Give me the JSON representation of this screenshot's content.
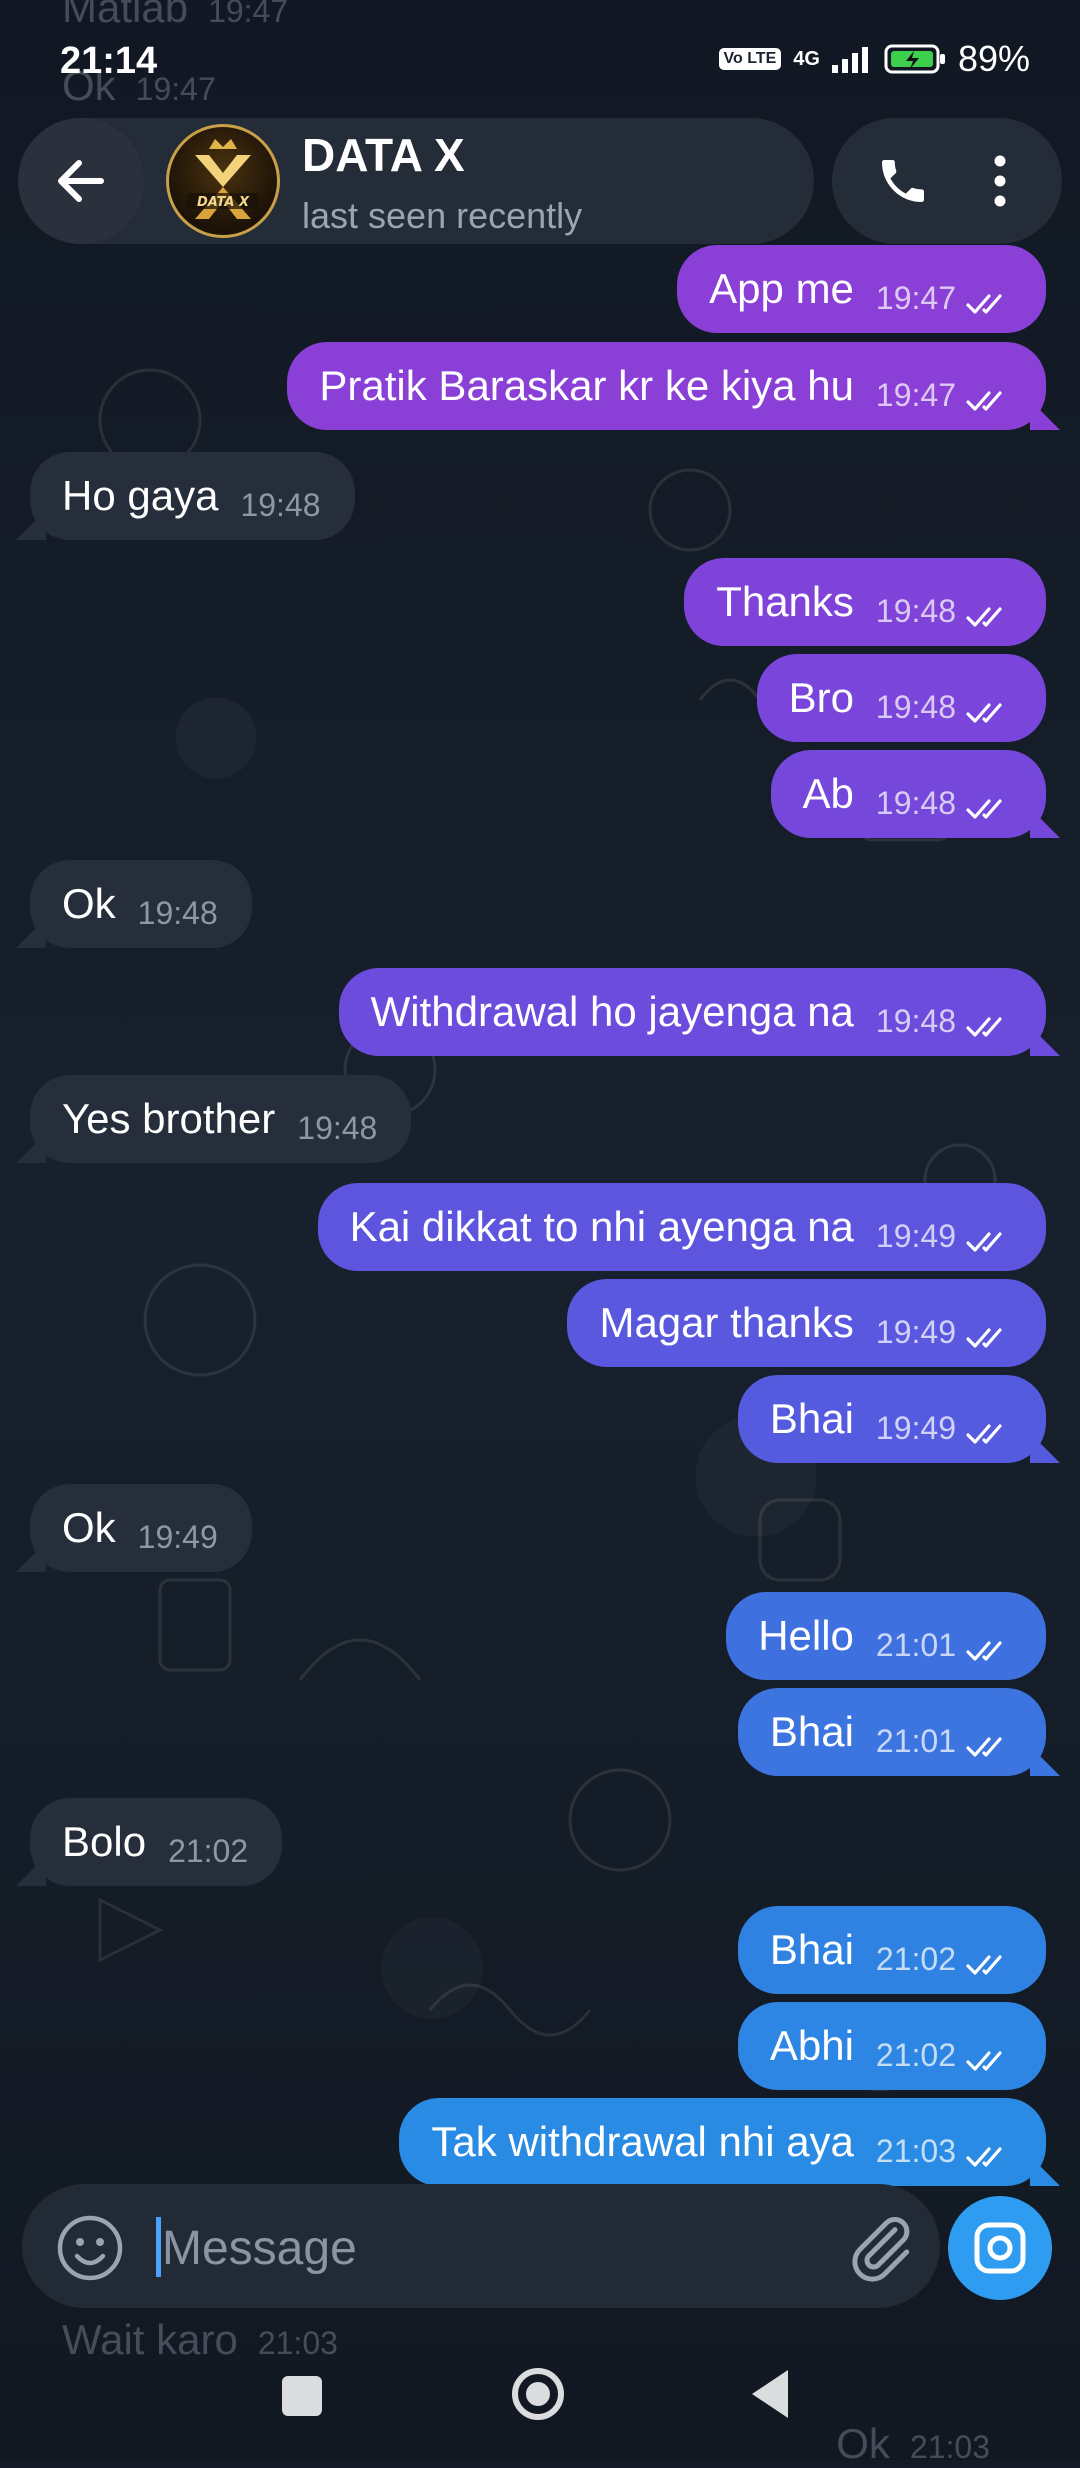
{
  "status_bar": {
    "time": "21:14",
    "volte": "Vo LTE",
    "network": "4G",
    "battery": "89%"
  },
  "header": {
    "title": "DATA X",
    "subtitle": "last seen recently",
    "avatar_text": "DATA X"
  },
  "faded_top": [
    {
      "text": "Matlab",
      "time": "19:47"
    },
    {
      "text": "Ok",
      "time": "19:47"
    }
  ],
  "messages": [
    {
      "dir": "out",
      "text": "App me",
      "time": "19:47",
      "color": "#8a3fd6",
      "read": true
    },
    {
      "dir": "out",
      "text": "Pratik Baraskar kr ke kiya hu",
      "time": "19:47",
      "color": "#8a3fd6",
      "read": true
    },
    {
      "dir": "in",
      "text": "Ho gaya",
      "time": "19:48"
    },
    {
      "dir": "out",
      "text": "Thanks",
      "time": "19:48",
      "color": "#7f43d9",
      "read": true
    },
    {
      "dir": "out",
      "text": "Bro",
      "time": "19:48",
      "color": "#7a45da",
      "read": true
    },
    {
      "dir": "out",
      "text": "Ab",
      "time": "19:48",
      "color": "#7547da",
      "read": true
    },
    {
      "dir": "in",
      "text": "Ok",
      "time": "19:48"
    },
    {
      "dir": "out",
      "text": "Withdrawal ho jayenga na",
      "time": "19:48",
      "color": "#6c4cdc",
      "read": true
    },
    {
      "dir": "in",
      "text": "Yes brother",
      "time": "19:48"
    },
    {
      "dir": "out",
      "text": "Kai dikkat to nhi ayenga na",
      "time": "19:49",
      "color": "#5e55de",
      "read": true
    },
    {
      "dir": "out",
      "text": "Magar thanks",
      "time": "19:49",
      "color": "#5958df",
      "read": true
    },
    {
      "dir": "out",
      "text": "Bhai",
      "time": "19:49",
      "color": "#545bdf",
      "read": true
    },
    {
      "dir": "in",
      "text": "Ok",
      "time": "19:49"
    },
    {
      "dir": "out",
      "text": "Hello",
      "time": "21:01",
      "color": "#3f70df",
      "read": true
    },
    {
      "dir": "out",
      "text": "Bhai",
      "time": "21:01",
      "color": "#3c74e0",
      "read": true
    },
    {
      "dir": "in",
      "text": "Bolo",
      "time": "21:02"
    },
    {
      "dir": "out",
      "text": "Bhai",
      "time": "21:02",
      "color": "#2f82e2",
      "read": true
    },
    {
      "dir": "out",
      "text": "Abhi",
      "time": "21:02",
      "color": "#2d86e3",
      "read": true
    },
    {
      "dir": "out",
      "text": "Tak withdrawal nhi aya",
      "time": "21:03",
      "color": "#2a8be4",
      "read": true
    }
  ],
  "faded_bottom": [
    {
      "text": "Wait karo",
      "time": "21:03"
    },
    {
      "text": "Ok",
      "time": "21:03"
    }
  ],
  "input": {
    "placeholder": "Message",
    "value": ""
  },
  "colors": {
    "background": "#141b26",
    "incoming_bubble": "#252e3a",
    "camera_button": "#2e9cf0",
    "caret": "#4aa1ff"
  }
}
